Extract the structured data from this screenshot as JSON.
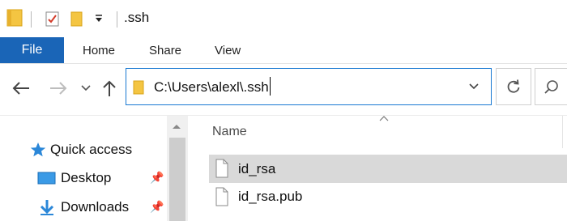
{
  "window": {
    "title": ".ssh"
  },
  "ribbon": {
    "tabs": [
      {
        "label": "File"
      },
      {
        "label": "Home"
      },
      {
        "label": "Share"
      },
      {
        "label": "View"
      }
    ]
  },
  "address_bar": {
    "path": "C:\\Users\\alexl\\.ssh"
  },
  "nav_pane": {
    "items": [
      {
        "label": "Quick access",
        "icon": "star-icon"
      },
      {
        "label": "Desktop",
        "icon": "desktop-icon",
        "pinned": true
      },
      {
        "label": "Downloads",
        "icon": "download-icon",
        "pinned": true
      }
    ]
  },
  "file_list": {
    "column_name": "Name",
    "files": [
      {
        "name": "id_rsa",
        "selected": true
      },
      {
        "name": "id_rsa.pub",
        "selected": false
      }
    ]
  },
  "colors": {
    "accent": "#1a65b7",
    "address_border": "#1979d2",
    "selection": "#d9d9d9",
    "folder": "#f4c542"
  }
}
